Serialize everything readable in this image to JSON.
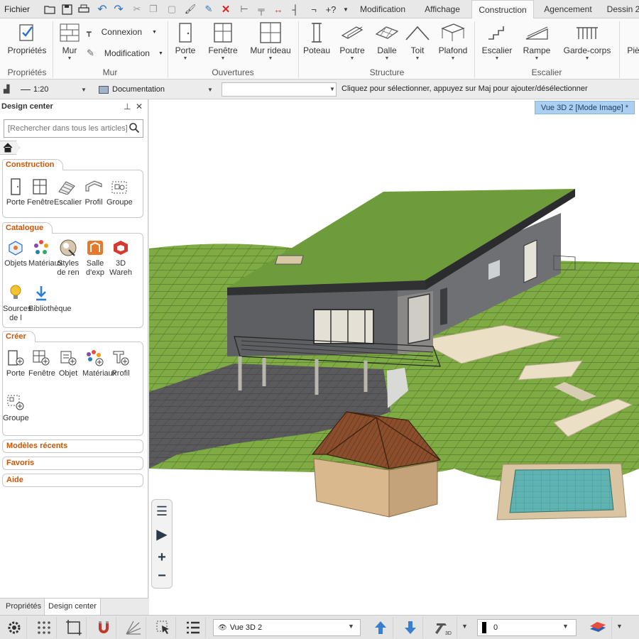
{
  "menubar": {
    "file_label": "Fichier",
    "tabs": [
      "Modification",
      "Affichage",
      "Construction",
      "Agencement",
      "Dessin 2"
    ],
    "active_tab": "Construction"
  },
  "ribbon": {
    "proprietes": "Propriétés",
    "mur": "Mur",
    "connexion": "Connexion",
    "modification": "Modification",
    "porte": "Porte",
    "fenetre": "Fenêtre",
    "mur_rideau": "Mur rideau",
    "poteau": "Poteau",
    "poutre": "Poutre",
    "dalle": "Dalle",
    "toit": "Toit",
    "plafond": "Plafond",
    "escalier": "Escalier",
    "rampe": "Rampe",
    "garde_corps": "Garde-corps",
    "piece": "Piè",
    "groups": {
      "proprietes": "Propriétés",
      "mur": "Mur",
      "ouvertures": "Ouvertures",
      "structure": "Structure",
      "escalier": "Escalier"
    }
  },
  "optbar": {
    "scale": "1:20",
    "layer": "Documentation",
    "hint": "Cliquez pour sélectionner, appuyez sur Maj pour ajouter/désélectionner"
  },
  "panel": {
    "title": "Design center",
    "search_placeholder": "[Rechercher dans tous les articles]",
    "sections": {
      "construction": {
        "title": "Construction",
        "items": [
          "Porte",
          "Fenêtre",
          "Escalier",
          "Profil",
          "Groupe"
        ]
      },
      "catalogue": {
        "title": "Catalogue",
        "items": [
          "Objets",
          "Matériaux",
          "Styles de ren",
          "Salle d'exp",
          "3D Wareh",
          "Sources de l",
          "Bibliothèque"
        ]
      },
      "creer": {
        "title": "Créer",
        "items": [
          "Porte",
          "Fenêtre",
          "Objet",
          "Matériaux",
          "Profil",
          "Groupe"
        ]
      },
      "recent": "Modèles récents",
      "favoris": "Favoris",
      "aide": "Aide"
    },
    "bottom_tabs": [
      "Propriétés",
      "Design center"
    ]
  },
  "viewport": {
    "tab_label": "Vue 3D 2 [Mode Image] *"
  },
  "bottombar": {
    "view_name": "Vue 3D 2",
    "elevation": "0"
  },
  "colors": {
    "accent_orange": "#d35400",
    "view_tab_blue": "#a9d0f1",
    "roof_green": "#6e9a3c",
    "grass_green": "#7eab44"
  }
}
